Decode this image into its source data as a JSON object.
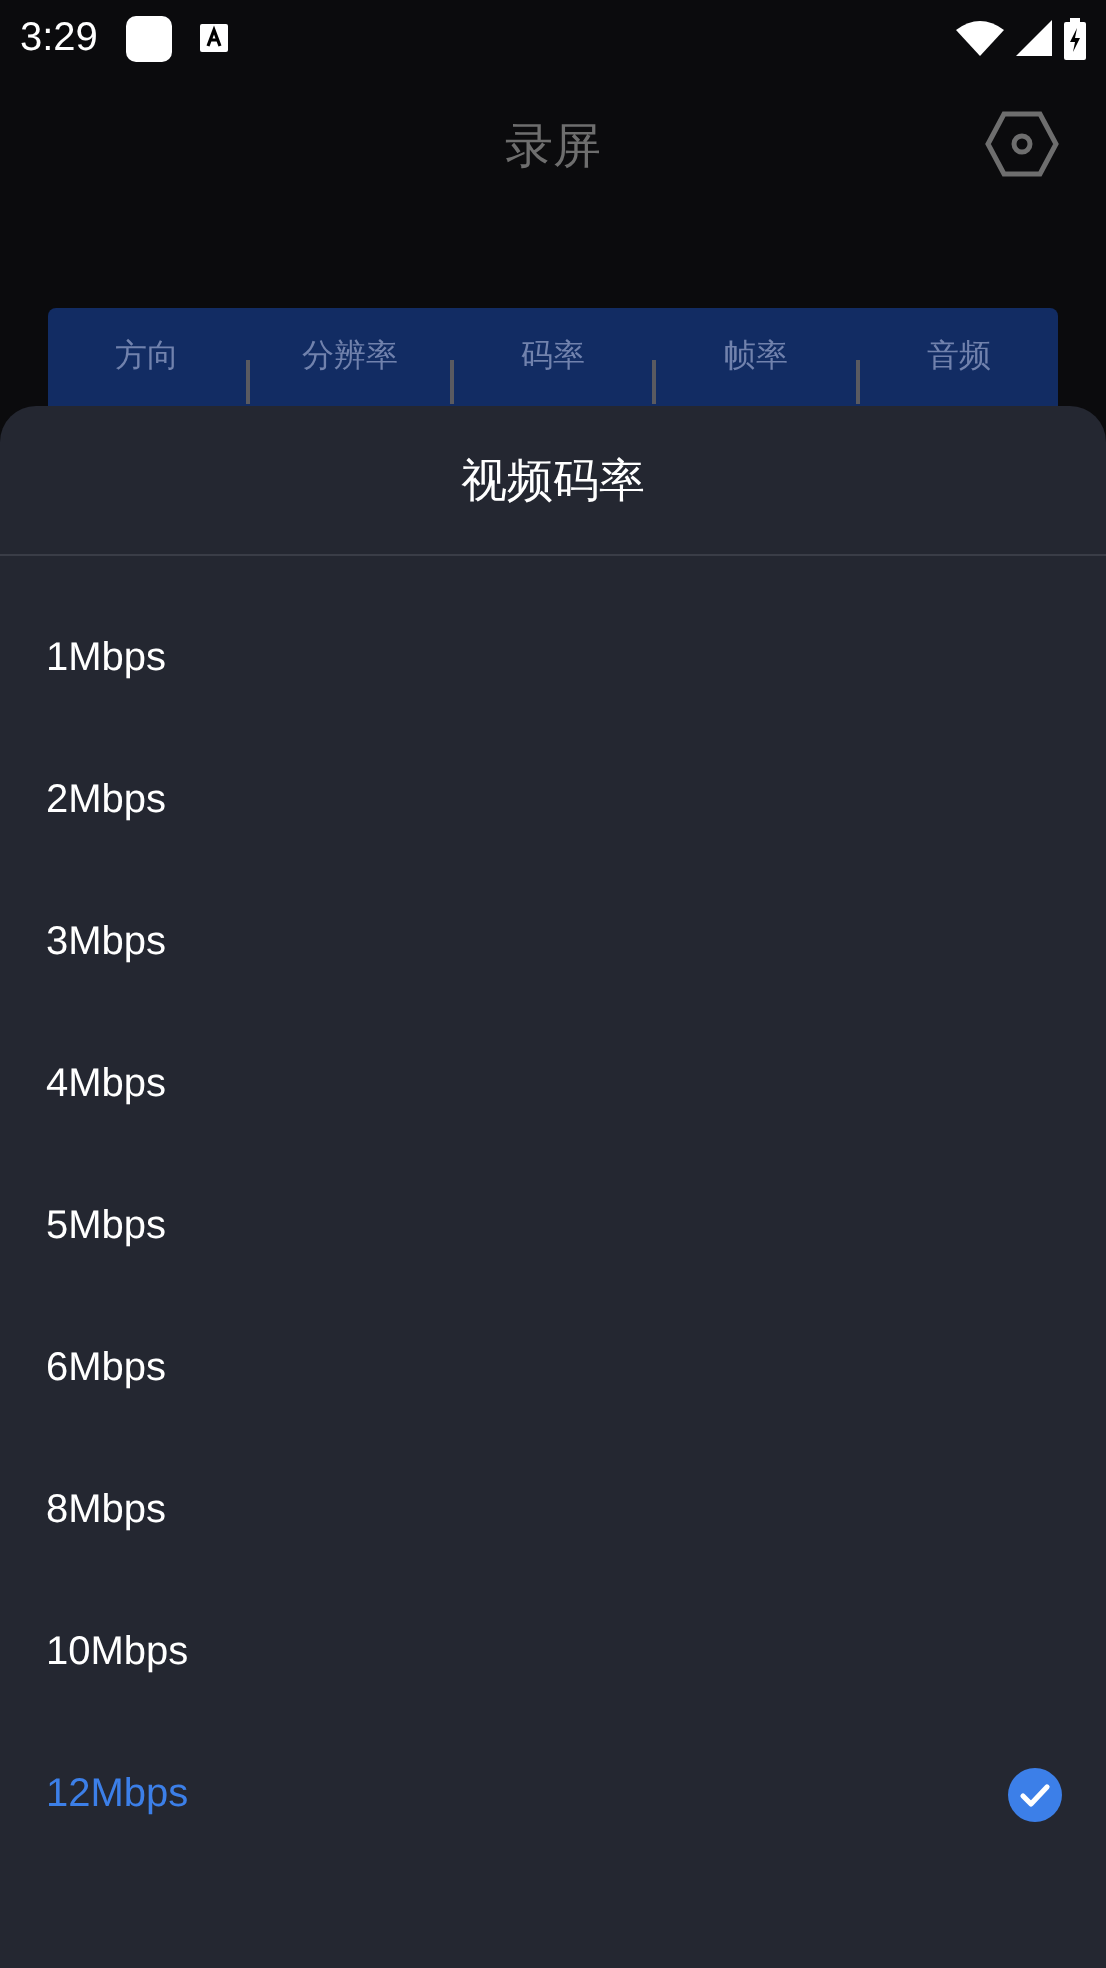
{
  "status_bar": {
    "time": "3:29"
  },
  "header": {
    "title": "录屏"
  },
  "tabs": [
    {
      "label": "方向"
    },
    {
      "label": "分辨率"
    },
    {
      "label": "码率"
    },
    {
      "label": "帧率"
    },
    {
      "label": "音频"
    }
  ],
  "sheet": {
    "title": "视频码率",
    "options": [
      {
        "label": "1Mbps",
        "selected": false
      },
      {
        "label": "2Mbps",
        "selected": false
      },
      {
        "label": "3Mbps",
        "selected": false
      },
      {
        "label": "4Mbps",
        "selected": false
      },
      {
        "label": "5Mbps",
        "selected": false
      },
      {
        "label": "6Mbps",
        "selected": false
      },
      {
        "label": "8Mbps",
        "selected": false
      },
      {
        "label": "10Mbps",
        "selected": false
      },
      {
        "label": "12Mbps",
        "selected": true
      }
    ]
  }
}
